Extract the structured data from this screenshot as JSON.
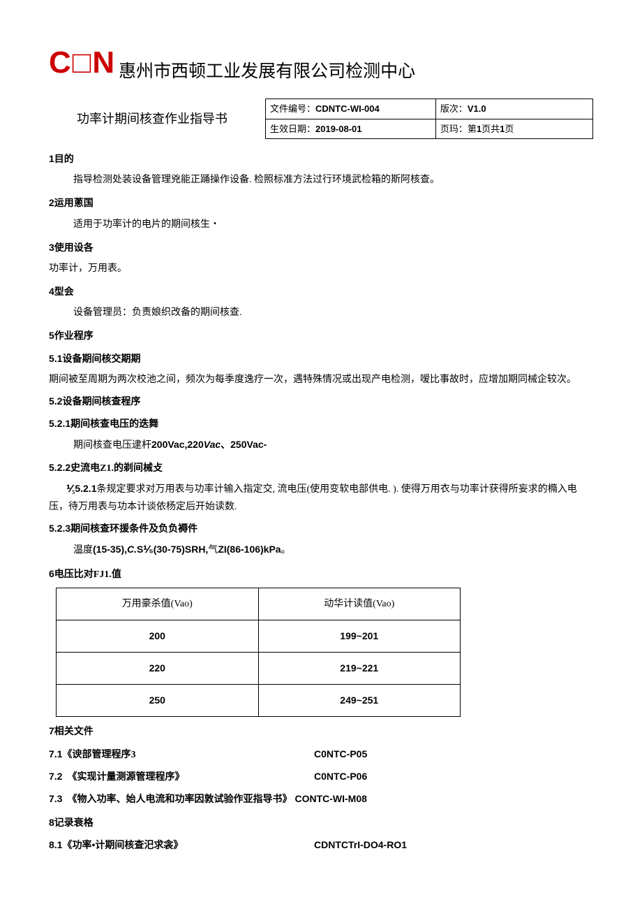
{
  "logo": "C□N",
  "company": "惠州市西顿工业发展有限公司检测中心",
  "doc_title": "功率计期间核查作业指导书",
  "meta": {
    "doc_no_label": "文件编号：",
    "doc_no": "CDNTC-WI-004",
    "version_label": "版次：",
    "version": "V1.0",
    "date_label": "生效日期：",
    "date": "2019-08-01",
    "page_label": "页玛：第",
    "page_cur": "1",
    "page_mid": "页共",
    "page_total": "1",
    "page_suffix": "页"
  },
  "s1": {
    "num": "1",
    "title": "目的",
    "text": "指导检测处装设备管理兇能正踊操作设备. 检照标准方法过行环境武检箱的斯阿核查。"
  },
  "s2": {
    "num": "2",
    "title": "运用蔥国",
    "text": "适用于功率计的电片的期间核生・"
  },
  "s3": {
    "num": "3",
    "title": "使用设各",
    "text": "功率计，万用表。"
  },
  "s4": {
    "num": "4",
    "title": "型会",
    "text": "设备管理员：负责娘织改备的期间核查."
  },
  "s5": {
    "num": "5",
    "title": "作业程序"
  },
  "s5_1": {
    "num": "5.1",
    "title": "设备期间核交期期",
    "text": "期间被至周期为两次校池之间，频次为每季度逸疗一次，遇特殊情况或出现产电检测，嗳比事故时，应增加期同械企较次。"
  },
  "s5_2": {
    "num": "5.2",
    "title": "设备期间核查程序"
  },
  "s5_2_1": {
    "num": "5.2.1",
    "title": "期间核查电压的迭舞",
    "text_prefix": "期间核查电压逮杆",
    "text_bold": "200Vac,220",
    "text_italic": "Vac",
    "text_bold2": "、250Vac-"
  },
  "s5_2_2": {
    "num": "5.2.2",
    "title": "史流电Z1.的剃间械攴",
    "text_prefix": "⅟₅",
    "text_bold": "5.2.1",
    "text_rest": "条规定要求对万用表与功率计输入指定交, 流电压(使用变软电部供电. ). 使得万用衣与功率计获得所妄求的橢入电压，待万用表与功本计谈依杨定后开始读数."
  },
  "s5_2_3": {
    "num": "5.2.3",
    "title": "期间核查环援条件及负负褥件",
    "text_prefix": "温度",
    "text_bold1": "(15-35),",
    "text_italic": "C.",
    "text_bold2": "S⅟₅(30-75)SRH,",
    "text_mid": "气",
    "text_bold3": "ZI(86-106)kPa",
    "text_suffix": "。"
  },
  "s6": {
    "num": "6",
    "title": "电压比对FJ1.值"
  },
  "chart_data": {
    "type": "table",
    "headers": [
      "万用豪杀值(Vao)",
      "动华计读值(Vao)"
    ],
    "rows": [
      [
        "200",
        "199~201"
      ],
      [
        "220",
        "219~221"
      ],
      [
        "250",
        "249~251"
      ]
    ]
  },
  "s7": {
    "num": "7",
    "title": "相关文件"
  },
  "refs": [
    {
      "num": "7.1",
      "name": "《谀部管理程序3",
      "code": "C0NTC-P05"
    },
    {
      "num": "7.2",
      "name": "  《实现计量测源管理程序》",
      "code": "C0NTC-P06"
    },
    {
      "num": "7.3",
      "name": "  《物入功率、始人电流和功率因敦试验作亚指导书》",
      "code": "CONTC-WI-M08"
    }
  ],
  "s8": {
    "num": "8",
    "title": "记录衰格"
  },
  "rec": {
    "num": "8.1",
    "name": "《功率•计期间核查汜求衾》",
    "code": "CDNTCTrI-DO4-RO1"
  }
}
